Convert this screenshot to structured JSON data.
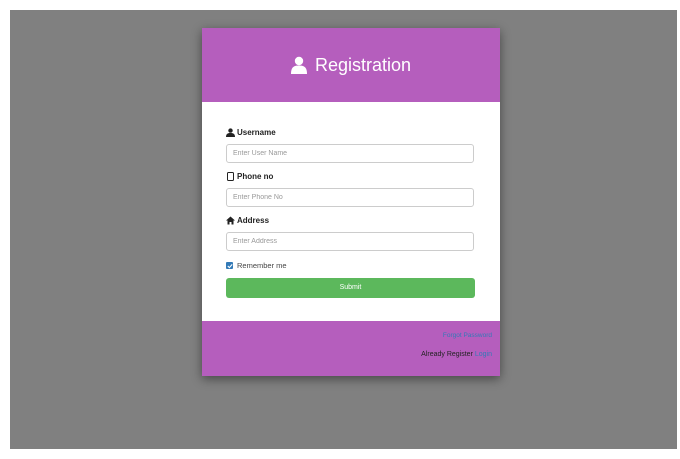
{
  "header": {
    "title": "Registration"
  },
  "form": {
    "username_label": "Username",
    "username_placeholder": "Enter User Name",
    "phone_label": "Phone no",
    "phone_placeholder": "Enter Phone No",
    "address_label": "Address",
    "address_placeholder": "Enter Address",
    "remember_label": "Remember me",
    "remember_checked": true,
    "submit_label": "Submit"
  },
  "footer": {
    "forgot_label": "Forgot Password",
    "already_text": "Already Register",
    "login_label": "Login"
  },
  "colors": {
    "header_bg": "#b55ebd",
    "submit_bg": "#5cb85c",
    "link": "#337ab7",
    "backdrop": "#808080"
  }
}
